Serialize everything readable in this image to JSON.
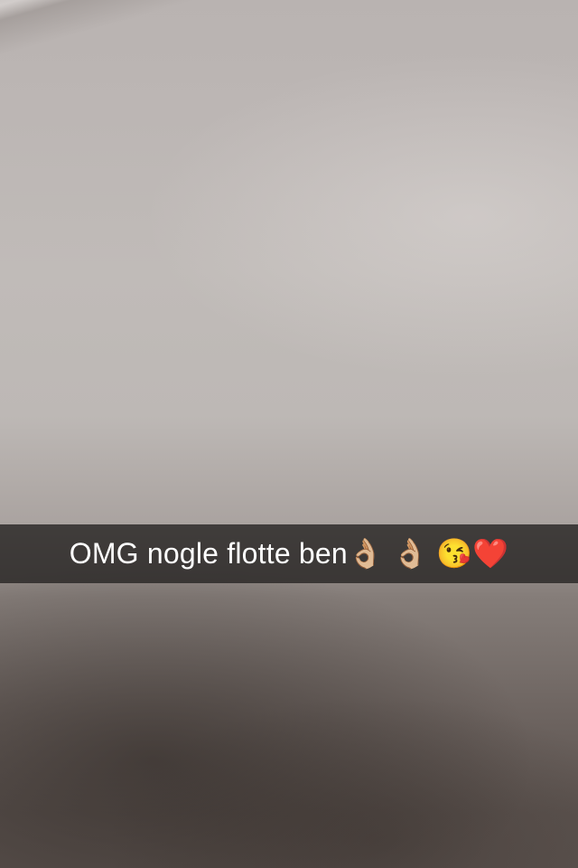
{
  "snap": {
    "caption": "OMG nogle flotte ben👌🏼 👌🏼 😘❤️"
  }
}
